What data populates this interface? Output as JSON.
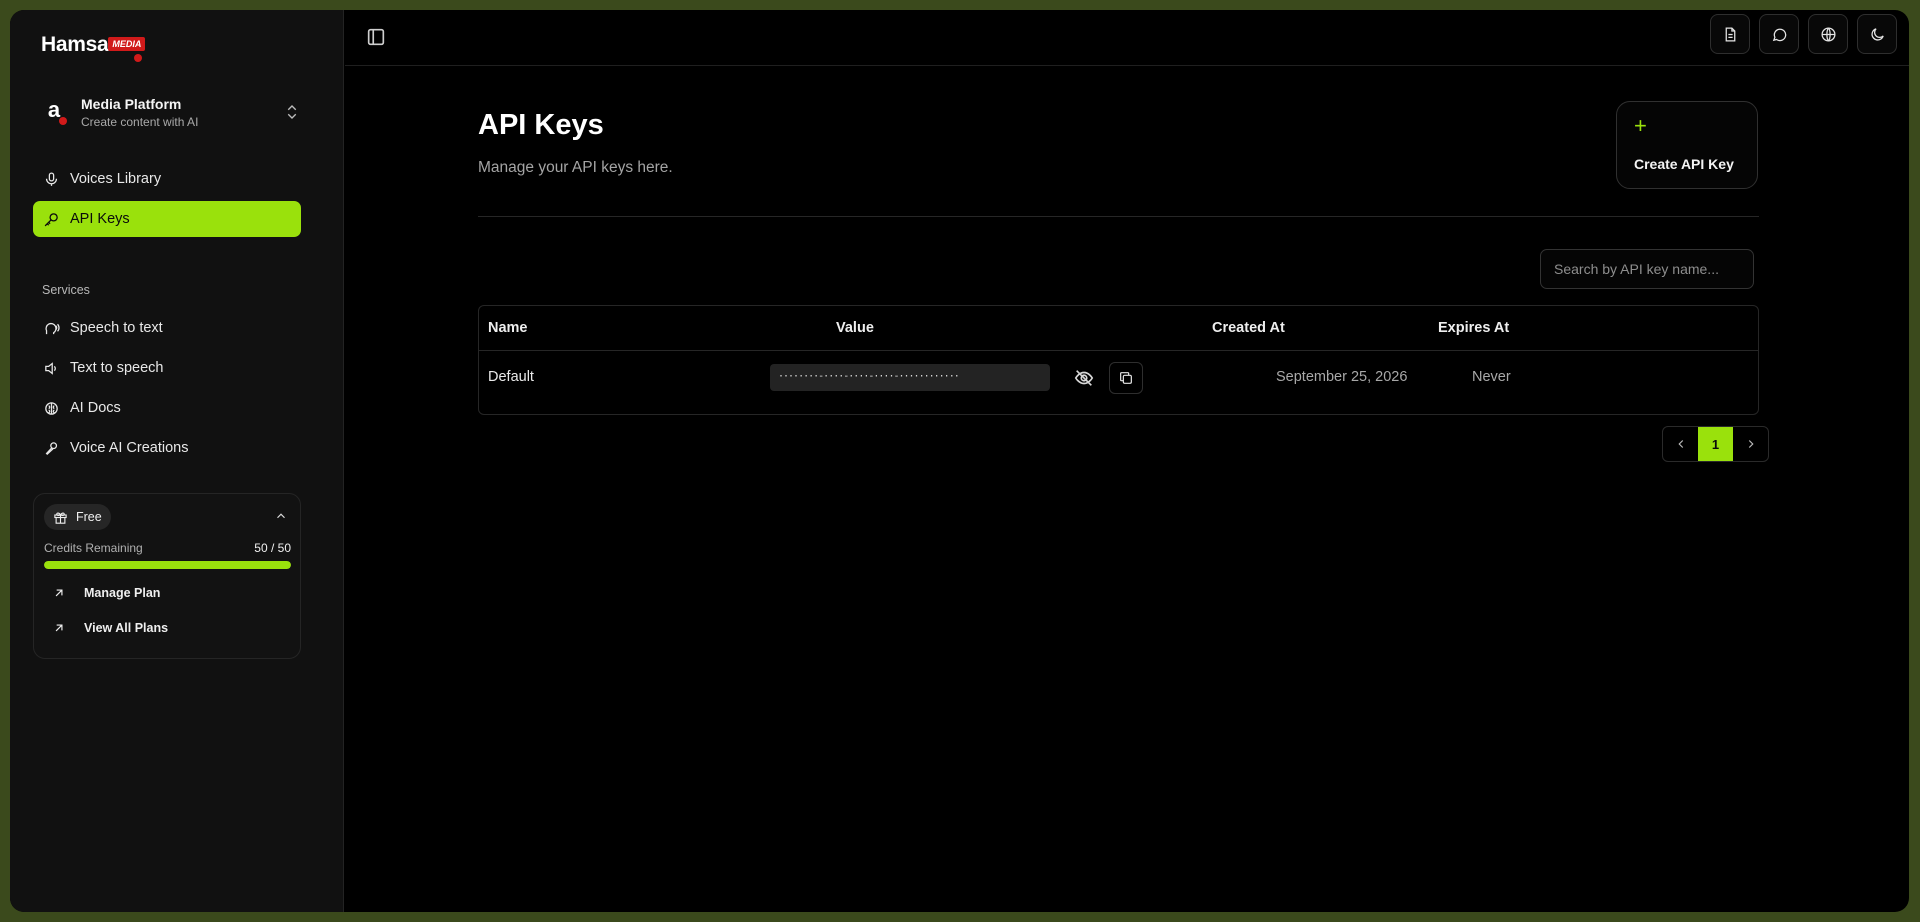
{
  "brand": {
    "name": "Hamsa",
    "tag": "MEDIA"
  },
  "workspace": {
    "avatar_letter": "a",
    "title": "Media Platform",
    "subtitle": "Create content with AI"
  },
  "nav_top": [
    {
      "label": "Voices Library",
      "icon": "mic-icon",
      "active": false
    },
    {
      "label": "API Keys",
      "icon": "key-icon",
      "active": true
    }
  ],
  "services": {
    "label": "Services",
    "items": [
      {
        "label": "Speech to text",
        "icon": "speech-head-icon"
      },
      {
        "label": "Text to speech",
        "icon": "speaker-icon"
      },
      {
        "label": "AI Docs",
        "icon": "brain-icon"
      },
      {
        "label": "Voice AI Creations",
        "icon": "feather-mic-icon"
      }
    ]
  },
  "credits": {
    "plan": "Free",
    "label": "Credits Remaining",
    "value": "50 / 50",
    "fraction": 1.0,
    "links": [
      "Manage Plan",
      "View All Plans"
    ]
  },
  "page": {
    "title": "API Keys",
    "subtitle": "Manage your API keys here.",
    "create_label": "Create API Key",
    "search_placeholder": "Search by API key name..."
  },
  "table": {
    "columns": [
      "Name",
      "Value",
      "Created At",
      "Expires At"
    ],
    "rows": [
      {
        "name": "Default",
        "value": "········-····-····-····-············",
        "created": "September 25, 2026",
        "expires": "Never"
      }
    ]
  },
  "pagination": {
    "current": "1"
  },
  "colors": {
    "accent": "#9ae10c",
    "brand_red": "#d11a1a",
    "background": "#000000"
  }
}
